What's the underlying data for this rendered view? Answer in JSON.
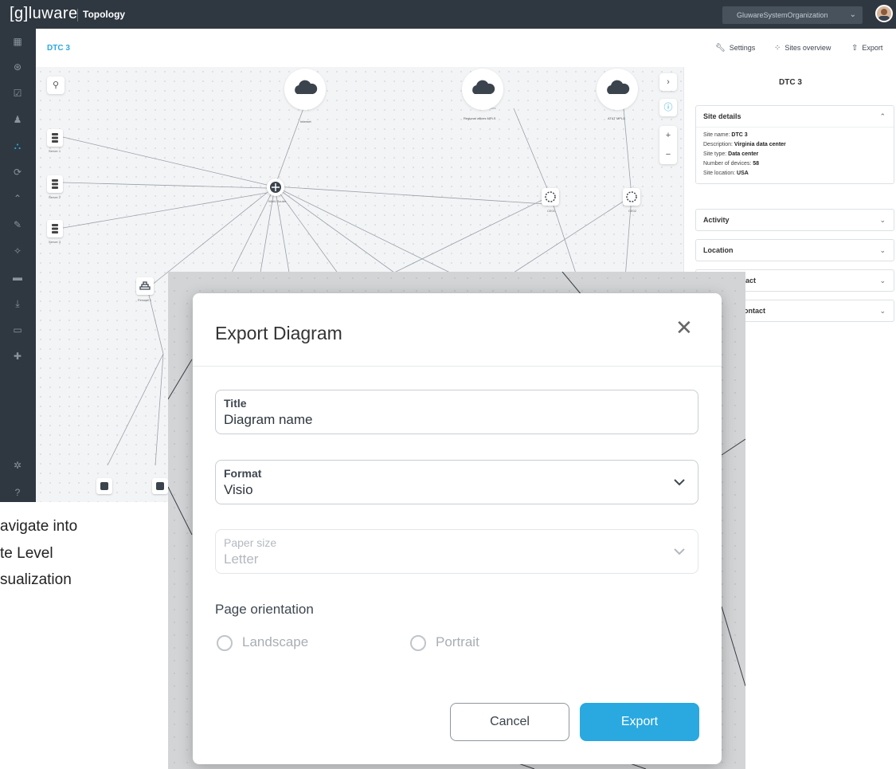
{
  "topbar": {
    "brand": "[g]luware",
    "app_name": "Topology",
    "org_selector": "GluwareSystemOrganization"
  },
  "header": {
    "breadcrumb": "DTC 3",
    "settings_label": "Settings",
    "sites_overview_label": "Sites overview",
    "export_label": "Export"
  },
  "canvas": {
    "clouds": [
      {
        "label": "Internet"
      },
      {
        "label": "Regional offices MPLS"
      },
      {
        "label": "AT&T MPLS"
      }
    ],
    "servers": [
      {
        "label": "Server 1"
      },
      {
        "label": "Server 2"
      },
      {
        "label": "Server 3"
      }
    ],
    "hubs": [
      {
        "label": "WAN Router"
      },
      {
        "label": "CE01"
      },
      {
        "label": "CE02"
      }
    ],
    "firewall_label": "Firewall 1"
  },
  "panel": {
    "title": "DTC 3",
    "site_details": {
      "heading": "Site details",
      "name_key": "Site name:",
      "name_val": "DTC 3",
      "desc_key": "Description:",
      "desc_val": "Virginia data center",
      "type_key": "Site type:",
      "type_val": "Data center",
      "devices_key": "Number of devices:",
      "devices_val": "58",
      "location_key": "Site location:",
      "location_val": "USA"
    },
    "sections": [
      "Activity",
      "Location",
      "act",
      "ontact"
    ]
  },
  "caption": {
    "line1": "avigate into",
    "line2": "te Level",
    "line3": "sualization"
  },
  "modal": {
    "title": "Export Diagram",
    "title_field": {
      "label": "Title",
      "value": "Diagram name"
    },
    "format_field": {
      "label": "Format",
      "value": "Visio"
    },
    "paper_field": {
      "label": "Paper size",
      "value": "Letter"
    },
    "orientation_label": "Page orientation",
    "orientation_options": [
      "Landscape",
      "Portrait"
    ],
    "cancel_label": "Cancel",
    "export_label": "Export"
  },
  "colors": {
    "accent": "#2aa8e0",
    "topbar": "#2f3841"
  }
}
